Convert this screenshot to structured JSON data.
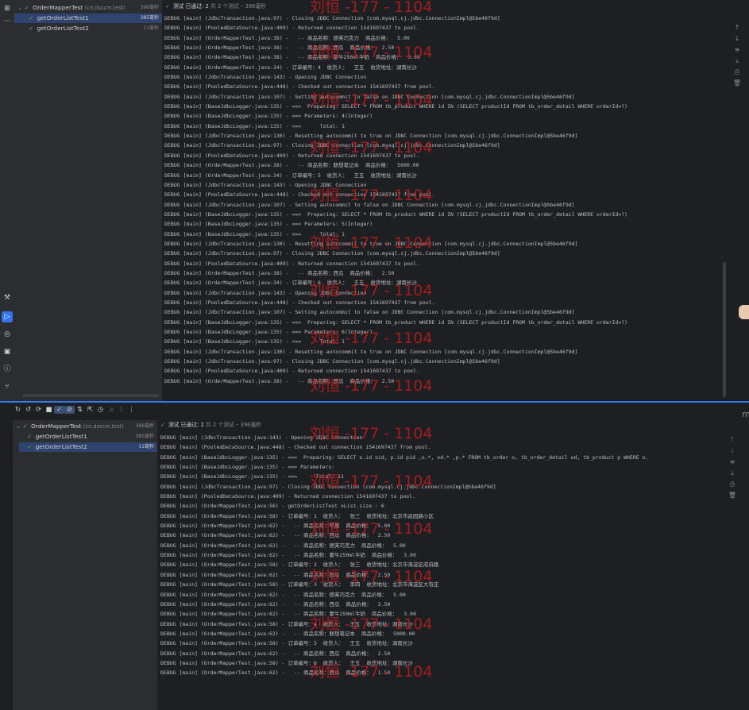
{
  "top": {
    "tree": {
      "root": {
        "label": "OrderMapperTest",
        "pkg": "(cn.dsscm.test)",
        "duration": "396毫秒"
      },
      "items": [
        {
          "label": "getOrderListTest1",
          "duration": "385毫秒"
        },
        {
          "label": "getOrderListTest2",
          "duration": "11毫秒"
        }
      ]
    },
    "status": {
      "passed": "测试 已通过: 2",
      "total": "共 2 个测试 – 396毫秒"
    },
    "lines": [
      "DEBUG [main] (JdbcTransaction.java:97) - Closing JDBC Connection [com.mysql.cj.jdbc.ConnectionImpl@5be46f9d]",
      "DEBUG [main] (PooledDataSource.java:409) - Returned connection 1541697437 to pool.",
      "DEBUG [main] (OrderMapperTest.java:38) -   -- 商品名称：德芙巧克力  商品价格：  5.00",
      "DEBUG [main] (OrderMapperTest.java:38) -   -- 商品名称：西瓜  商品价格：  2.50",
      "DEBUG [main] (OrderMapperTest.java:38) -   -- 商品名称：蒙牛250ml牛奶  商品价格：  3.00",
      "DEBUG [main] (OrderMapperTest.java:34) - 订单编号：4  收货人：  王五  收货地址：湖南长沙",
      "DEBUG [main] (JdbcTransaction.java:143) - Opening JDBC Connection",
      "DEBUG [main] (PooledDataSource.java:448) - Checked out connection 1541697437 from pool.",
      "DEBUG [main] (JdbcTransaction.java:107) - Setting autocommit to false on JDBC Connection [com.mysql.cj.jdbc.ConnectionImpl@5be46f9d]",
      "DEBUG [main] (BaseJdbcLogger.java:135) - ==>  Preparing: SELECT * FROM tb_product WHERE id IN (SELECT productId FROM tb_order_detail WHERE orderId=?)",
      "DEBUG [main] (BaseJdbcLogger.java:135) - ==> Parameters: 4(Integer)",
      "DEBUG [main] (BaseJdbcLogger.java:135) - <==      Total: 1",
      "DEBUG [main] (JdbcTransaction.java:130) - Resetting autocommit to true on JDBC Connection [com.mysql.cj.jdbc.ConnectionImpl@5be46f9d]",
      "DEBUG [main] (JdbcTransaction.java:97) - Closing JDBC Connection [com.mysql.cj.jdbc.ConnectionImpl@5be46f9d]",
      "DEBUG [main] (PooledDataSource.java:409) - Returned connection 1541697437 to pool.",
      "DEBUG [main] (OrderMapperTest.java:38) -   -- 商品名称：联想笔记本  商品价格：  5000.00",
      "DEBUG [main] (OrderMapperTest.java:34) - 订单编号：5  收货人：  王五  收货地址：湖南长沙",
      "DEBUG [main] (JdbcTransaction.java:143) - Opening JDBC Connection",
      "DEBUG [main] (PooledDataSource.java:448) - Checked out connection 1541697437 from pool.",
      "DEBUG [main] (JdbcTransaction.java:107) - Setting autocommit to false on JDBC Connection [com.mysql.cj.jdbc.ConnectionImpl@5be46f9d]",
      "DEBUG [main] (BaseJdbcLogger.java:135) - ==>  Preparing: SELECT * FROM tb_product WHERE id IN (SELECT productId FROM tb_order_detail WHERE orderId=?)",
      "DEBUG [main] (BaseJdbcLogger.java:135) - ==> Parameters: 5(Integer)",
      "DEBUG [main] (BaseJdbcLogger.java:135) - <==      Total: 1",
      "DEBUG [main] (JdbcTransaction.java:130) - Resetting autocommit to true on JDBC Connection [com.mysql.cj.jdbc.ConnectionImpl@5be46f9d]",
      "DEBUG [main] (JdbcTransaction.java:97) - Closing JDBC Connection [com.mysql.cj.jdbc.ConnectionImpl@5be46f9d]",
      "DEBUG [main] (PooledDataSource.java:409) - Returned connection 1541697437 to pool.",
      "DEBUG [main] (OrderMapperTest.java:38) -   -- 商品名称：西瓜  商品价格：  2.50",
      "DEBUG [main] (OrderMapperTest.java:34) - 订单编号：6  收货人：  王五  收货地址：湖南长沙",
      "DEBUG [main] (JdbcTransaction.java:143) - Opening JDBC Connection",
      "DEBUG [main] (PooledDataSource.java:448) - Checked out connection 1541697437 from pool.",
      "DEBUG [main] (JdbcTransaction.java:107) - Setting autocommit to false on JDBC Connection [com.mysql.cj.jdbc.ConnectionImpl@5be46f9d]",
      "DEBUG [main] (BaseJdbcLogger.java:135) - ==>  Preparing: SELECT * FROM tb_product WHERE id IN (SELECT productId FROM tb_order_detail WHERE orderId=?)",
      "DEBUG [main] (BaseJdbcLogger.java:135) - ==> Parameters: 6(Integer)",
      "DEBUG [main] (BaseJdbcLogger.java:135) - <==      Total: 1",
      "DEBUG [main] (JdbcTransaction.java:130) - Resetting autocommit to true on JDBC Connection [com.mysql.cj.jdbc.ConnectionImpl@5be46f9d]",
      "DEBUG [main] (JdbcTransaction.java:97) - Closing JDBC Connection [com.mysql.cj.jdbc.ConnectionImpl@5be46f9d]",
      "DEBUG [main] (PooledDataSource.java:409) - Returned connection 1541697437 to pool.",
      "DEBUG [main] (OrderMapperTest.java:38) -   -- 商品名称：西瓜  商品价格：  2.50"
    ]
  },
  "bottom": {
    "tree": {
      "root": {
        "label": "OrderMapperTest",
        "pkg": "(cn.dsscm.test)",
        "duration": "396毫秒"
      },
      "items": [
        {
          "label": "getOrderListTest1",
          "duration": "385毫秒"
        },
        {
          "label": "getOrderListTest2",
          "duration": "11毫秒"
        }
      ]
    },
    "status": {
      "passed": "测试 已通过: 2",
      "total": "共 2 个测试 – 396毫秒"
    },
    "lines": [
      "DEBUG [main] (JdbcTransaction.java:143) - Opening JDBC Connection",
      "DEBUG [main] (PooledDataSource.java:448) - Checked out connection 1541697437 from pool.",
      "DEBUG [main] (BaseJdbcLogger.java:135) - ==>  Preparing: SELECT o.id oid, p.id pid ,o.*, od.* ,p.* FROM tb_order o, tb_order_detail od, tb_product p WHERE o.",
      "DEBUG [main] (BaseJdbcLogger.java:135) - ==> Parameters: ",
      "DEBUG [main] (BaseJdbcLogger.java:135) - <==      Total: 11",
      "DEBUG [main] (JdbcTransaction.java:97) - Closing JDBC Connection [com.mysql.cj.jdbc.ConnectionImpl@5be46f9d]",
      "DEBUG [main] (PooledDataSource.java:409) - Returned connection 1541697437 to pool.",
      "DEBUG [main] (OrderMapperTest.java:56) - getOrderListTest oList.size : 6",
      "DEBUG [main] (OrderMapperTest.java:58) - 订单编号：1  收货人：  张三  收货地址：北京市昌园路小区",
      "DEBUG [main] (OrderMapperTest.java:62) -   -- 商品名称：苹果  商品价格：  5.00",
      "DEBUG [main] (OrderMapperTest.java:62) -   -- 商品名称：西瓜  商品价格：  2.50",
      "DEBUG [main] (OrderMapperTest.java:62) -   -- 商品名称：德芙巧克力  商品价格：  5.00",
      "DEBUG [main] (OrderMapperTest.java:62) -   -- 商品名称：蒙牛250ml牛奶  商品价格：  3.00",
      "DEBUG [main] (OrderMapperTest.java:58) - 订单编号：2  收货人：  张三  收货地址：北京市海淀区成府路",
      "DEBUG [main] (OrderMapperTest.java:62) -   -- 商品名称：西瓜  商品价格：  2.50",
      "DEBUG [main] (OrderMapperTest.java:58) - 订单编号：3  收货人：  李四  收货地址：北京市海淀区大有庄",
      "DEBUG [main] (OrderMapperTest.java:62) -   -- 商品名称：德芙巧克力  商品价格：  5.00",
      "DEBUG [main] (OrderMapperTest.java:62) -   -- 商品名称：西瓜  商品价格：  2.50",
      "DEBUG [main] (OrderMapperTest.java:62) -   -- 商品名称：蒙牛250ml牛奶  商品价格：  3.00",
      "DEBUG [main] (OrderMapperTest.java:58) - 订单编号：4  收货人：  王五  收货地址：湖南长沙",
      "DEBUG [main] (OrderMapperTest.java:62) -   -- 商品名称：联想笔记本  商品价格：  5000.00",
      "DEBUG [main] (OrderMapperTest.java:58) - 订单编号：5  收货人：  王五  收货地址：湖南长沙",
      "DEBUG [main] (OrderMapperTest.java:62) -   -- 商品名称：西瓜  商品价格：  2.50",
      "DEBUG [main] (OrderMapperTest.java:58) - 订单编号：6  收货人：  王五  收货地址：湖南长沙",
      "DEBUG [main] (OrderMapperTest.java:62) -   -- 商品名称：西瓜  商品价格：  1.50"
    ]
  },
  "watermark": "刘恒 -177 - 1104",
  "toolbar_icons": [
    "rerun-icon",
    "rerun-failed-icon",
    "toggle-auto-test-icon",
    "stop-icon",
    "show-passed-icon",
    "show-ignored-icon",
    "sort-icon",
    "collapse-icon",
    "history-icon",
    "import-icon",
    "export-icon",
    "more-icon"
  ],
  "colors": {
    "accent": "#3574f0",
    "passed": "#5fb865",
    "watermark": "#c81e1e"
  }
}
